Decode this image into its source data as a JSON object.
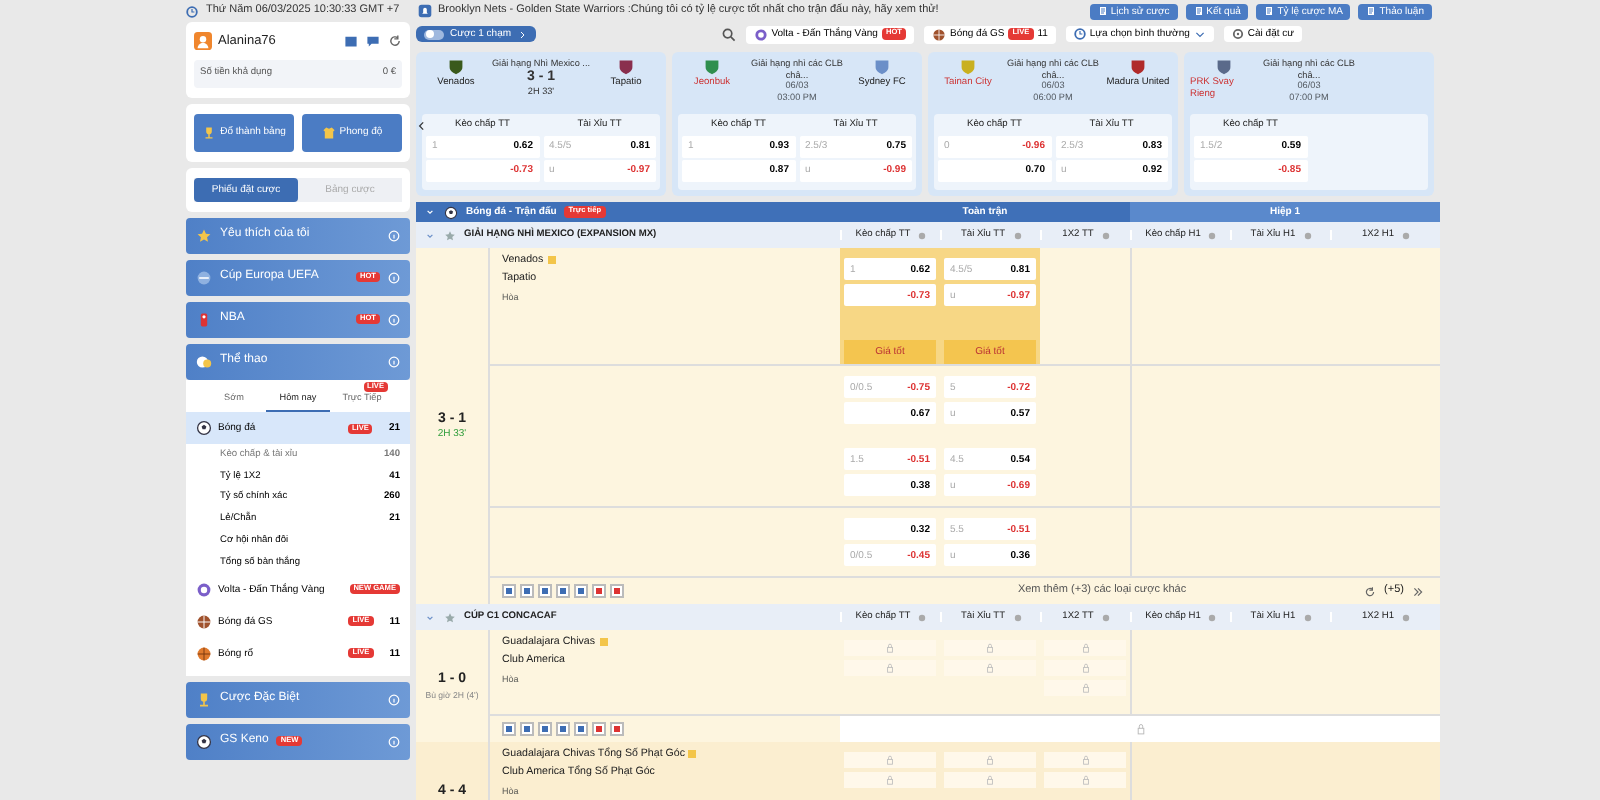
{
  "top_bar": {
    "datetime": "Thứ Năm 06/03/2025 10:30:33 GMT +7",
    "announcement": "Brooklyn Nets - Golden State Warriors :Chúng tôi có tỷ lệ cược tốt nhất cho trận đấu này, hãy xem thử!",
    "buttons": [
      "Lịch sử cược",
      "Kết quả",
      "Tỷ lệ cược MA",
      "Thảo luận"
    ]
  },
  "account": {
    "username": "Alanina76",
    "balance_label": "Số tiền khả dụng",
    "balance": "0 €"
  },
  "quick_buttons": [
    "Đổ thành bảng",
    "Phong độ"
  ],
  "slip_tabs": [
    {
      "label": "Phiếu đặt cược",
      "selected": true
    },
    {
      "label": "Bảng cược",
      "selected": false
    }
  ],
  "menu_sections": [
    {
      "label": "Yêu thích của tôi"
    },
    {
      "label": "Cúp Europa UEFA",
      "badge": "HOT"
    },
    {
      "label": "NBA",
      "badge": "HOT"
    },
    {
      "label": "Thể thao"
    }
  ],
  "sport_tabs": [
    {
      "label": "Sớm",
      "selected": false
    },
    {
      "label": "Hôm nay",
      "selected": true
    },
    {
      "label": "Trực Tiếp",
      "selected": false,
      "badge": "LIVE"
    }
  ],
  "sports": [
    {
      "label": "Bóng đá",
      "badge": "LIVE",
      "count": "21",
      "selected": true,
      "children": [
        {
          "label": "Kèo chấp & tài xỉu",
          "count": "140"
        },
        {
          "label": "Tỷ lệ 1X2",
          "count": "41"
        },
        {
          "label": "Tỷ số chính xác",
          "count": "260"
        },
        {
          "label": "Lẻ/Chẵn",
          "count": "21"
        },
        {
          "label": "Cơ hội nhân đôi"
        },
        {
          "label": "Tổng số bàn thắng"
        }
      ]
    },
    {
      "label": "Volta - Đấn Thắng Vàng",
      "badge": "NEW GAME",
      "selected": false
    },
    {
      "label": "Bóng đá GS",
      "badge": "LIVE",
      "count": "11",
      "selected": false
    },
    {
      "label": "Bóng rổ",
      "badge": "LIVE",
      "count": "11",
      "selected": false
    }
  ],
  "bottom_sections": [
    {
      "label": "Cược Đặc Biệt"
    },
    {
      "label": "GS Keno",
      "badge": "NEW"
    }
  ],
  "toolbar": {
    "one_click": {
      "label": "Cược 1 chạm",
      "on": false
    },
    "quick_links": [
      {
        "label": "Volta - Đấn Thắng Vàng",
        "badge": "HOT"
      },
      {
        "label": "Bóng đá GS",
        "badge": "LIVE",
        "count": "11"
      }
    ],
    "odds_mode": "Lựa chọn bình thường",
    "settings": "Cài đặt cư"
  },
  "featured_matches": [
    {
      "league": "Giải hạng Nhì Mexico ...",
      "home": {
        "name": "Venados"
      },
      "away": {
        "name": "Tapatio"
      },
      "score": "3 - 1",
      "time": "2H 33'",
      "markets": [
        {
          "label": "Kèo chấp TT",
          "cells": [
            {
              "line": "1",
              "odds": "0.62"
            },
            {
              "odds": "-0.73"
            }
          ]
        },
        {
          "label": "Tài Xỉu TT",
          "cells": [
            {
              "line": "4.5/5",
              "odds": "0.81"
            },
            {
              "line": "u",
              "odds": "-0.97"
            }
          ]
        }
      ]
    },
    {
      "league": "Giải hạng nhì các CLB châ...",
      "home": {
        "name": "Jeonbuk"
      },
      "away": {
        "name": "Sydney FC"
      },
      "date": "06/03",
      "time": "03:00 PM",
      "markets": [
        {
          "label": "Kèo chấp TT",
          "cells": [
            {
              "line": "1",
              "odds": "0.93"
            },
            {
              "odds": "0.87"
            }
          ]
        },
        {
          "label": "Tài Xỉu TT",
          "cells": [
            {
              "line": "2.5/3",
              "odds": "0.75"
            },
            {
              "line": "u",
              "odds": "-0.99"
            }
          ]
        }
      ]
    },
    {
      "league": "Giải hạng nhì các CLB châ...",
      "home": {
        "name": "Tainan City"
      },
      "away": {
        "name": "Madura United"
      },
      "date": "06/03",
      "time": "06:00 PM",
      "markets": [
        {
          "label": "Kèo chấp TT",
          "cells": [
            {
              "line": "0",
              "odds": "-0.96"
            },
            {
              "odds": "0.70"
            }
          ]
        },
        {
          "label": "Tài Xỉu TT",
          "cells": [
            {
              "line": "2.5/3",
              "odds": "0.83"
            },
            {
              "line": "u",
              "odds": "0.92"
            }
          ]
        }
      ]
    },
    {
      "league": "Giải hạng nhì các CLB châ...",
      "home": {
        "name": "PRK Svay Rieng"
      },
      "date": "06/03",
      "time": "07:00 PM",
      "markets": [
        {
          "label": "Kèo chấp TT",
          "cells": [
            {
              "line": "1.5/2",
              "odds": "0.59"
            },
            {
              "odds": "-0.85"
            }
          ]
        }
      ]
    }
  ],
  "table": {
    "title": "Bóng đá - Trận đấu",
    "live_badge": "Trực tiếp",
    "groups": [
      "Toàn trận",
      "Hiệp 1"
    ],
    "leagues": [
      {
        "name": "GIẢI HẠNG NHÌ MEXICO (EXPANSION MX)",
        "columns": [
          "Kèo chấp TT",
          "Tài Xỉu TT",
          "1X2 TT",
          "Kèo chấp H1",
          "Tài Xỉu H1",
          "1X2 H1"
        ],
        "matches": [
          {
            "score": "3 - 1",
            "time": "2H 33'",
            "home": "Venados",
            "away": "Tapatio",
            "draw": "Hòa",
            "more": "Xem thêm (+3) các loại cược khác",
            "more_count": "(+5)",
            "blocks": [
              {
                "highlighted": true,
                "best_labels": [
                  "Giá tốt",
                  "Giá tốt"
                ],
                "hdp": [
                  {
                    "line": "1",
                    "odds": "0.62"
                  },
                  {
                    "odds": "-0.73"
                  }
                ],
                "ou": [
                  {
                    "line": "4.5/5",
                    "odds": "0.81"
                  },
                  {
                    "line": "u",
                    "odds": "-0.97"
                  }
                ]
              },
              {
                "highlighted": false,
                "hdp": [
                  {
                    "line": "0/0.5",
                    "odds": "-0.75"
                  },
                  {
                    "odds": "0.67"
                  },
                  {
                    "line": "1.5",
                    "odds": "-0.51"
                  },
                  {
                    "odds": "0.38"
                  }
                ],
                "ou": [
                  {
                    "line": "5",
                    "odds": "-0.72"
                  },
                  {
                    "line": "u",
                    "odds": "0.57"
                  },
                  {
                    "line": "4.5",
                    "odds": "0.54"
                  },
                  {
                    "line": "u",
                    "odds": "-0.69"
                  }
                ]
              },
              {
                "highlighted": false,
                "hdp": [
                  {
                    "odds": "0.32"
                  },
                  {
                    "line": "0/0.5",
                    "odds": "-0.45"
                  }
                ],
                "ou": [
                  {
                    "line": "5.5",
                    "odds": "-0.51"
                  },
                  {
                    "line": "u",
                    "odds": "0.36"
                  }
                ]
              }
            ]
          }
        ]
      },
      {
        "name": "CÚP C1 CONCACAF",
        "columns": [
          "Kèo chấp TT",
          "Tài Xỉu TT",
          "1X2 TT",
          "Kèo chấp H1",
          "Tài Xỉu H1",
          "1X2 H1"
        ],
        "matches": [
          {
            "score": "1 - 0",
            "time": "Bù giờ 2H (4')",
            "home": "Guadalajara Chivas",
            "away": "Club America",
            "draw": "Hòa"
          },
          {
            "score": "4 - 4",
            "home": "Guadalajara Chivas Tổng Số Phạt Góc",
            "away": "Club America Tổng Số Phạt Góc",
            "draw": "Hòa"
          }
        ]
      }
    ]
  }
}
